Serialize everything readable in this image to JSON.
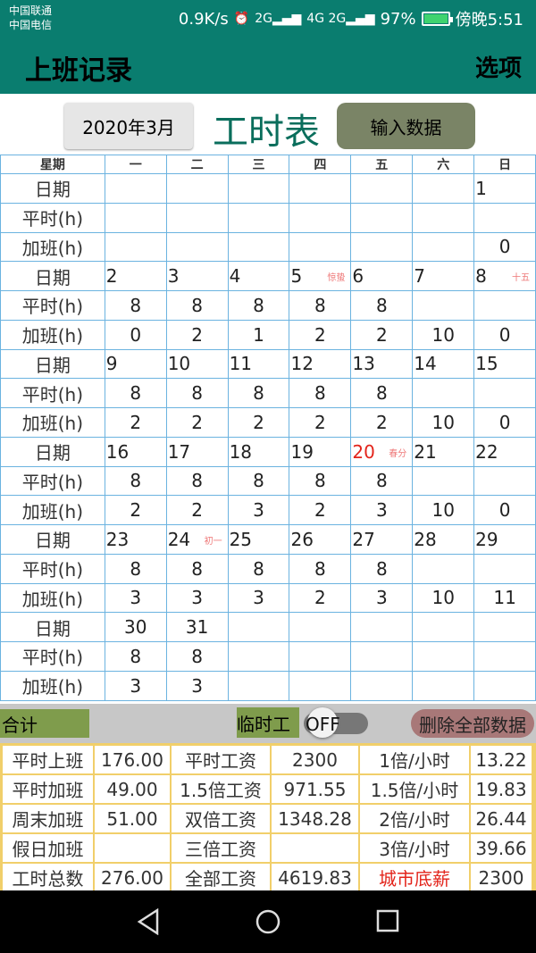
{
  "status": {
    "carrier1": "中国联通",
    "carrier2": "中国电信",
    "speed": "0.9K/s",
    "battery": "97%",
    "time": "傍晚5:51",
    "net1": "2G",
    "net2": "4G 2G"
  },
  "appbar": {
    "title": "上班记录",
    "menu": "选项"
  },
  "controls": {
    "month": "2020年3月",
    "sheet_title": "工时表",
    "input_button": "输入数据"
  },
  "calendar": {
    "weekday_header": "星期",
    "weekdays": [
      "一",
      "二",
      "三",
      "四",
      "五",
      "六",
      "日"
    ],
    "labels": {
      "date": "日期",
      "regular": "平时(h)",
      "overtime": "加班(h)"
    },
    "weeks": [
      {
        "dates": [
          "",
          "",
          "",
          "",
          "",
          "",
          "1"
        ],
        "regular": [
          "",
          "",
          "",
          "",
          "",
          "",
          ""
        ],
        "overtime": [
          "",
          "",
          "",
          "",
          "",
          "",
          "0"
        ]
      },
      {
        "dates": [
          "2",
          "3",
          "4",
          "5",
          "6",
          "7",
          "8"
        ],
        "lunar": [
          "",
          "",
          "",
          "惊蛰",
          "",
          "",
          "十五"
        ],
        "regular": [
          "8",
          "8",
          "8",
          "8",
          "8",
          "",
          ""
        ],
        "overtime": [
          "0",
          "2",
          "1",
          "2",
          "2",
          "10",
          "0"
        ]
      },
      {
        "dates": [
          "9",
          "10",
          "11",
          "12",
          "13",
          "14",
          "15"
        ],
        "regular": [
          "8",
          "8",
          "8",
          "8",
          "8",
          "",
          ""
        ],
        "overtime": [
          "2",
          "2",
          "2",
          "2",
          "2",
          "10",
          "0"
        ]
      },
      {
        "dates": [
          "16",
          "17",
          "18",
          "19",
          "20",
          "21",
          "22"
        ],
        "lunar": [
          "",
          "",
          "",
          "",
          "春分",
          "",
          ""
        ],
        "regular": [
          "8",
          "8",
          "8",
          "8",
          "8",
          "",
          ""
        ],
        "overtime": [
          "2",
          "2",
          "3",
          "2",
          "3",
          "10",
          "0"
        ]
      },
      {
        "dates": [
          "23",
          "24",
          "25",
          "26",
          "27",
          "28",
          "29"
        ],
        "lunar": [
          "",
          "初一",
          "",
          "",
          "",
          "",
          ""
        ],
        "regular": [
          "8",
          "8",
          "8",
          "8",
          "8",
          "",
          ""
        ],
        "overtime": [
          "3",
          "3",
          "3",
          "2",
          "3",
          "10",
          "11"
        ]
      },
      {
        "dates": [
          "30",
          "31",
          "",
          "",
          "",
          "",
          ""
        ],
        "regular": [
          "8",
          "8",
          "",
          "",
          "",
          "",
          ""
        ],
        "overtime": [
          "3",
          "3",
          "",
          "",
          "",
          "",
          ""
        ]
      }
    ]
  },
  "summary": {
    "total_label": "合计",
    "temp_label": "临时工",
    "toggle_state": "OFF",
    "delete_button": "删除全部数据"
  },
  "totals": [
    [
      "平时上班",
      "176.00",
      "平时工资",
      "2300",
      "1倍/小时",
      "13.22"
    ],
    [
      "平时加班",
      "49.00",
      "1.5倍工资",
      "971.55",
      "1.5倍/小时",
      "19.83"
    ],
    [
      "周末加班",
      "51.00",
      "双倍工资",
      "1348.28",
      "2倍/小时",
      "26.44"
    ],
    [
      "假日加班",
      "",
      "三倍工资",
      "",
      "3倍/小时",
      "39.66"
    ],
    [
      "工时总数",
      "276.00",
      "全部工资",
      "4619.83",
      "城市底薪",
      "2300"
    ]
  ],
  "colors": {
    "appbar": "#0a7d6f",
    "accent_red": "#e3241b",
    "grid": "#6bb3e0",
    "sum_green": "#7f9c4c",
    "total_gold": "#f1cf6a"
  }
}
